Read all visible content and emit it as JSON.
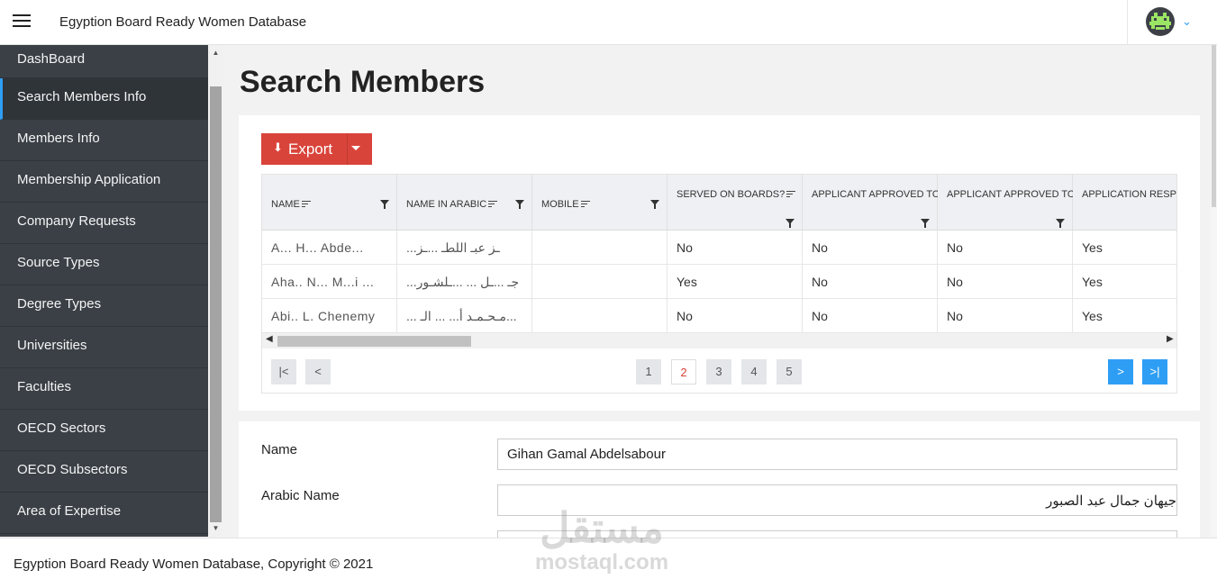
{
  "header": {
    "app_title": "Egyption Board Ready Women Database",
    "icons": {
      "menu": "hamburger-icon",
      "user": "pixel-avatar-icon",
      "dropdown": "chevron-down-icon"
    },
    "accent_color": "#2e9ef5"
  },
  "sidebar": {
    "items": [
      {
        "label": "DashBoard"
      },
      {
        "label": "Search Members Info",
        "active": true
      },
      {
        "label": "Members Info"
      },
      {
        "label": "Membership Application"
      },
      {
        "label": "Company Requests"
      },
      {
        "label": "Source Types"
      },
      {
        "label": "Degree Types"
      },
      {
        "label": "Universities"
      },
      {
        "label": "Faculties"
      },
      {
        "label": "OECD Sectors"
      },
      {
        "label": "OECD Subsectors"
      },
      {
        "label": "Area of Expertise"
      }
    ]
  },
  "main": {
    "page_title": "Search Members",
    "export": {
      "label": "Export",
      "color": "#d9443a",
      "icon": "download-icon"
    },
    "grid": {
      "columns": [
        "NAME",
        "NAME IN ARABIC",
        "MOBILE",
        "SERVED ON BOARDS?",
        "APPLICANT APPROVED TO B",
        "APPLICANT APPROVED TO B",
        "APPLICATION RESPO"
      ],
      "rows": [
        [
          "A... H... Abde...",
          "...ـز عبـ اللطـ ...ـز",
          "",
          "No",
          "No",
          "No",
          "Yes"
        ],
        [
          "Aha.. N... M...i ...",
          "...جـ ...ـل ... ...ـلشـور",
          "",
          "Yes",
          "No",
          "No",
          "Yes"
        ],
        [
          "Abi.. L. Chenemy",
          "... مـحـمـد أ... ... الـ...",
          "",
          "No",
          "No",
          "No",
          "Yes"
        ]
      ]
    },
    "pagination": {
      "pages": [
        "1",
        "2",
        "3",
        "4",
        "5"
      ],
      "current_page": "2",
      "first": "|<",
      "prev": "<",
      "next": ">",
      "last": ">|"
    },
    "form": {
      "name_label": "Name",
      "name_value": "Gihan Gamal Abdelsabour",
      "arabic_name_label": "Arabic Name",
      "arabic_name_value": "جيهان جمال عبد الصبور"
    }
  },
  "footer": {
    "text": "Egyption Board Ready Women Database, Copyright © 2021"
  },
  "watermark": {
    "arabic": "مستقل",
    "latin": "mostaql.com"
  }
}
